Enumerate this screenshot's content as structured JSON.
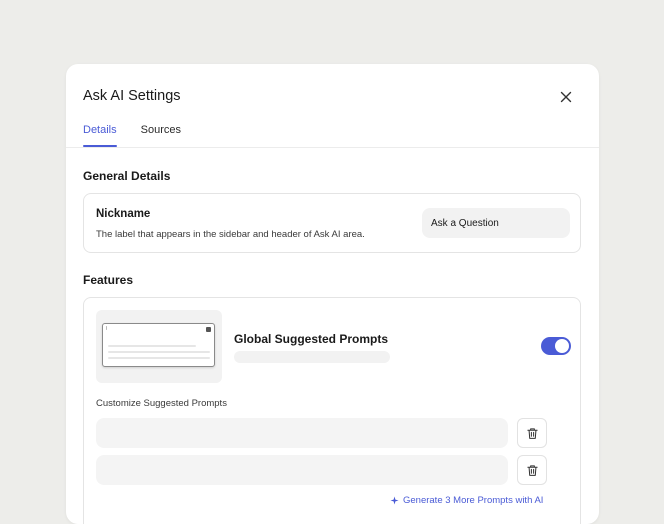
{
  "modal": {
    "title": "Ask AI Settings"
  },
  "tabs": [
    {
      "label": "Details",
      "active": true
    },
    {
      "label": "Sources",
      "active": false
    }
  ],
  "general": {
    "title": "General Details",
    "nickname": {
      "label": "Nickname",
      "description": "The label that appears in the sidebar and header of Ask AI area.",
      "value": "Ask a Question"
    }
  },
  "features": {
    "title": "Features",
    "global_prompts": {
      "title": "Global Suggested Prompts",
      "enabled": true
    },
    "customize_label": "Customize Suggested Prompts",
    "prompts": [
      {
        "value": ""
      },
      {
        "value": ""
      }
    ],
    "generate_link": "Generate 3 More Prompts with AI"
  },
  "colors": {
    "accent": "#4a5bd6",
    "background": "#ededea"
  },
  "icons": {
    "close": "close-icon",
    "trash": "trash-icon",
    "sparkle": "sparkle-icon"
  }
}
